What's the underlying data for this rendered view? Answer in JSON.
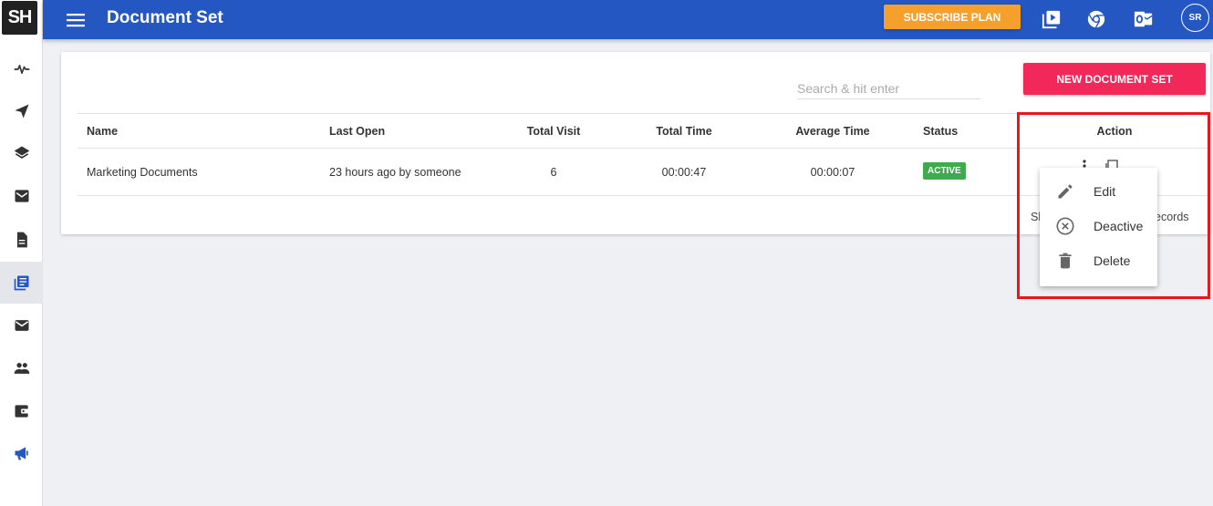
{
  "app": {
    "logo_text": "SH",
    "page_title": "Document Set"
  },
  "topbar": {
    "subscribe_label": "SUBSCRIBE PLAN",
    "icons": [
      "video-library-icon",
      "chrome-icon",
      "outlook-icon"
    ],
    "avatar_initials": "SR"
  },
  "sidebar": {
    "items": [
      {
        "icon": "activity-icon"
      },
      {
        "icon": "send-icon"
      },
      {
        "icon": "layers-icon"
      },
      {
        "icon": "mail-box-icon"
      },
      {
        "icon": "document-icon"
      },
      {
        "icon": "document-set-icon",
        "active": true
      },
      {
        "icon": "email-icon"
      },
      {
        "icon": "people-icon"
      },
      {
        "icon": "wallet-icon"
      },
      {
        "icon": "megaphone-icon"
      }
    ]
  },
  "toolbar": {
    "search_placeholder": "Search & hit enter",
    "new_button_label": "NEW DOCUMENT SET"
  },
  "table": {
    "headers": {
      "name": "Name",
      "last_open": "Last Open",
      "total_visit": "Total Visit",
      "total_time": "Total Time",
      "average_time": "Average Time",
      "status": "Status",
      "action": "Action"
    },
    "rows": [
      {
        "name": "Marketing Documents",
        "last_open": "23 hours ago by someone",
        "total_visit": "6",
        "total_time": "00:00:47",
        "average_time": "00:00:07",
        "status": "ACTIVE"
      }
    ],
    "footer_left": "Sh",
    "footer_right": "ecords"
  },
  "action_menu": {
    "items": [
      {
        "label": "Edit",
        "icon": "pencil-icon"
      },
      {
        "label": "Deactive",
        "icon": "cancel-circle-icon"
      },
      {
        "label": "Delete",
        "icon": "trash-icon"
      }
    ]
  },
  "colors": {
    "topbar": "#2557c2",
    "subscribe": "#f5a02c",
    "new_button": "#f2275a",
    "status_active": "#3fab4f",
    "highlight": "#e8171d"
  }
}
